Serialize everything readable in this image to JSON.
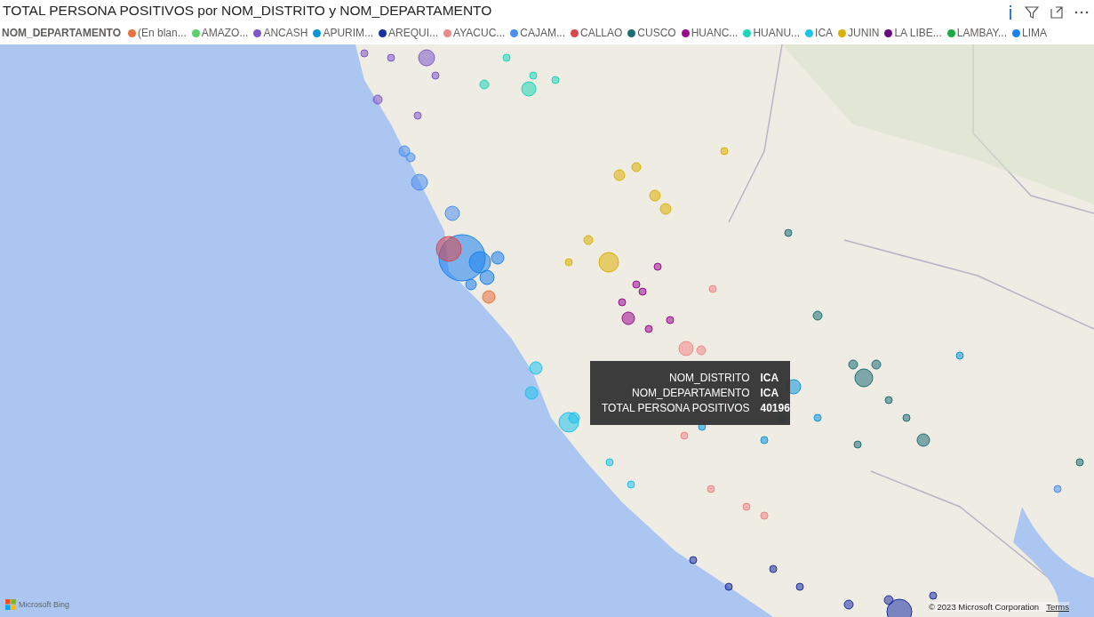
{
  "visual": {
    "title": "TOTAL PERSONA POSITIVOS por NOM_DISTRITO y NOM_DEPARTAMENTO"
  },
  "legend": {
    "title": "NOM_DEPARTAMENTO",
    "items": [
      {
        "label": "(En blan...",
        "color": "#e8703a"
      },
      {
        "label": "AMAZO...",
        "color": "#58cf6a"
      },
      {
        "label": "ANCASH",
        "color": "#7e57c8"
      },
      {
        "label": "APURIM...",
        "color": "#0e96d8"
      },
      {
        "label": "AREQUI...",
        "color": "#1a2fa0"
      },
      {
        "label": "AYACUC...",
        "color": "#f08888"
      },
      {
        "label": "CAJAM...",
        "color": "#4a90f0"
      },
      {
        "label": "CALLAO",
        "color": "#d9474f"
      },
      {
        "label": "CUSCO",
        "color": "#1e6e74"
      },
      {
        "label": "HUANC...",
        "color": "#9a0c8d"
      },
      {
        "label": "HUANU...",
        "color": "#1bd6b8"
      },
      {
        "label": "ICA",
        "color": "#1ec2ec"
      },
      {
        "label": "JUNIN",
        "color": "#dcb000"
      },
      {
        "label": "LA LIBE...",
        "color": "#6a0a80"
      },
      {
        "label": "LAMBAY...",
        "color": "#1aaa48"
      },
      {
        "label": "LIMA",
        "color": "#1a82f0"
      }
    ]
  },
  "tooltip": {
    "rows": [
      {
        "label": "NOM_DISTRITO",
        "value": "ICA"
      },
      {
        "label": "NOM_DEPARTAMENTO",
        "value": "ICA"
      },
      {
        "label": "TOTAL PERSONA POSITIVOS",
        "value": "40196"
      }
    ]
  },
  "map": {
    "attribution": "Microsoft Bing",
    "copyright": "© 2023 Microsoft Corporation",
    "terms_link": "Terms"
  }
}
